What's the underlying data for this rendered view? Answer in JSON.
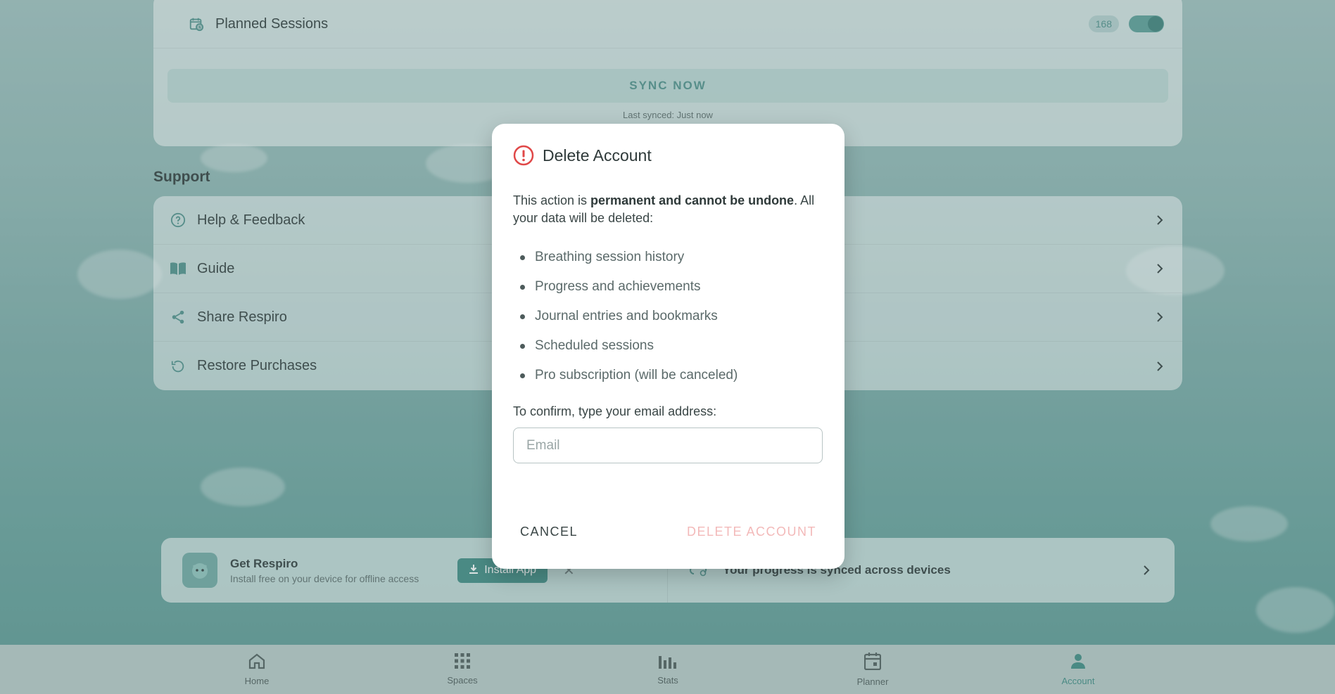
{
  "sync": {
    "planned_label": "Planned Sessions",
    "planned_count": "168",
    "sync_button": "SYNC NOW",
    "last_synced": "Last synced: Just now"
  },
  "support": {
    "title": "Support",
    "items": [
      {
        "label": "Help & Feedback",
        "icon": "help-circle-icon"
      },
      {
        "label": "Guide",
        "icon": "book-icon"
      },
      {
        "label": "Share Respiro",
        "icon": "share-icon"
      },
      {
        "label": "Restore Purchases",
        "icon": "restore-icon"
      }
    ]
  },
  "banner": {
    "title": "Get Respiro",
    "subtitle": "Install free on your device for offline access",
    "install_label": "Install App",
    "synced_text": "Your progress is synced across devices"
  },
  "nav": {
    "items": [
      {
        "label": "Home",
        "icon": "home-icon"
      },
      {
        "label": "Spaces",
        "icon": "grid-icon"
      },
      {
        "label": "Stats",
        "icon": "bar-chart-icon"
      },
      {
        "label": "Planner",
        "icon": "calendar-icon"
      },
      {
        "label": "Account",
        "icon": "person-icon"
      }
    ],
    "active": "Account"
  },
  "dialog": {
    "title": "Delete Account",
    "intro_pre": "This action is ",
    "intro_bold": "permanent and cannot be undone",
    "intro_post": ". All your data will be deleted:",
    "items": [
      "Breathing session history",
      "Progress and achievements",
      "Journal entries and bookmarks",
      "Scheduled sessions",
      "Pro subscription (will be canceled)"
    ],
    "confirm_label": "To confirm, type your email address:",
    "email_placeholder": "Email",
    "email_value": "",
    "cancel_label": "CANCEL",
    "delete_label": "DELETE ACCOUNT"
  },
  "colors": {
    "accent": "#3e8a82",
    "danger": "#e04848",
    "danger_disabled": "#f3b9b9"
  }
}
